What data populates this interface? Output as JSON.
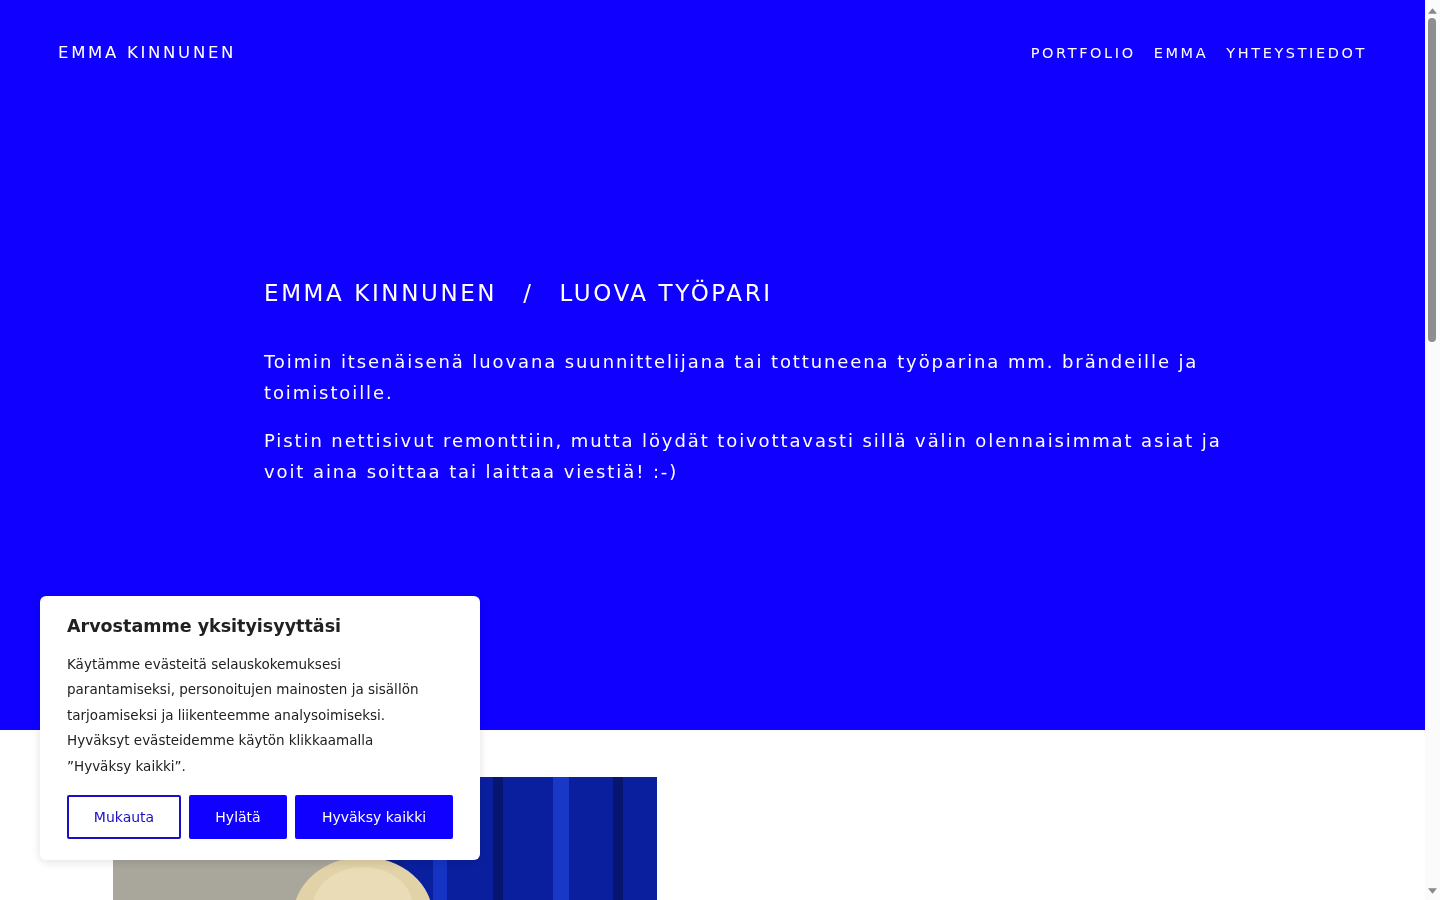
{
  "header": {
    "logo": "EMMA KINNUNEN",
    "nav": [
      {
        "label": "PORTFOLIO"
      },
      {
        "label": "EMMA"
      },
      {
        "label": "YHTEYSTIEDOT"
      }
    ]
  },
  "hero": {
    "name": "EMMA KINNUNEN",
    "separator": "/",
    "role": "LUOVA TYÖPARI",
    "paragraphs": [
      "Toimin itsenäisenä luovana suunnittelijana tai tottuneena työparina mm. brändeille ja toimistoille.",
      "Pistin nettisivut remonttiin, mutta löydät toivottavasti sillä välin olennaisimmat asiat ja voit aina soittaa tai laittaa viestiä! :-)"
    ]
  },
  "cookie_banner": {
    "title": "Arvostamme yksityisyyttäsi",
    "text": "Käytämme evästeitä selauskokemuksesi parantamiseksi, personoitujen mainosten ja sisällön tarjoamiseksi ja liikenteemme analysoimiseksi. Hyväksyt evästeidemme käytön klikkaamalla ”Hyväksy kaikki”.",
    "buttons": [
      {
        "label": "Mukauta",
        "kind": "outline"
      },
      {
        "label": "Hylätä",
        "kind": "filled"
      },
      {
        "label": "Hyväksy kaikki",
        "kind": "filled"
      }
    ]
  }
}
